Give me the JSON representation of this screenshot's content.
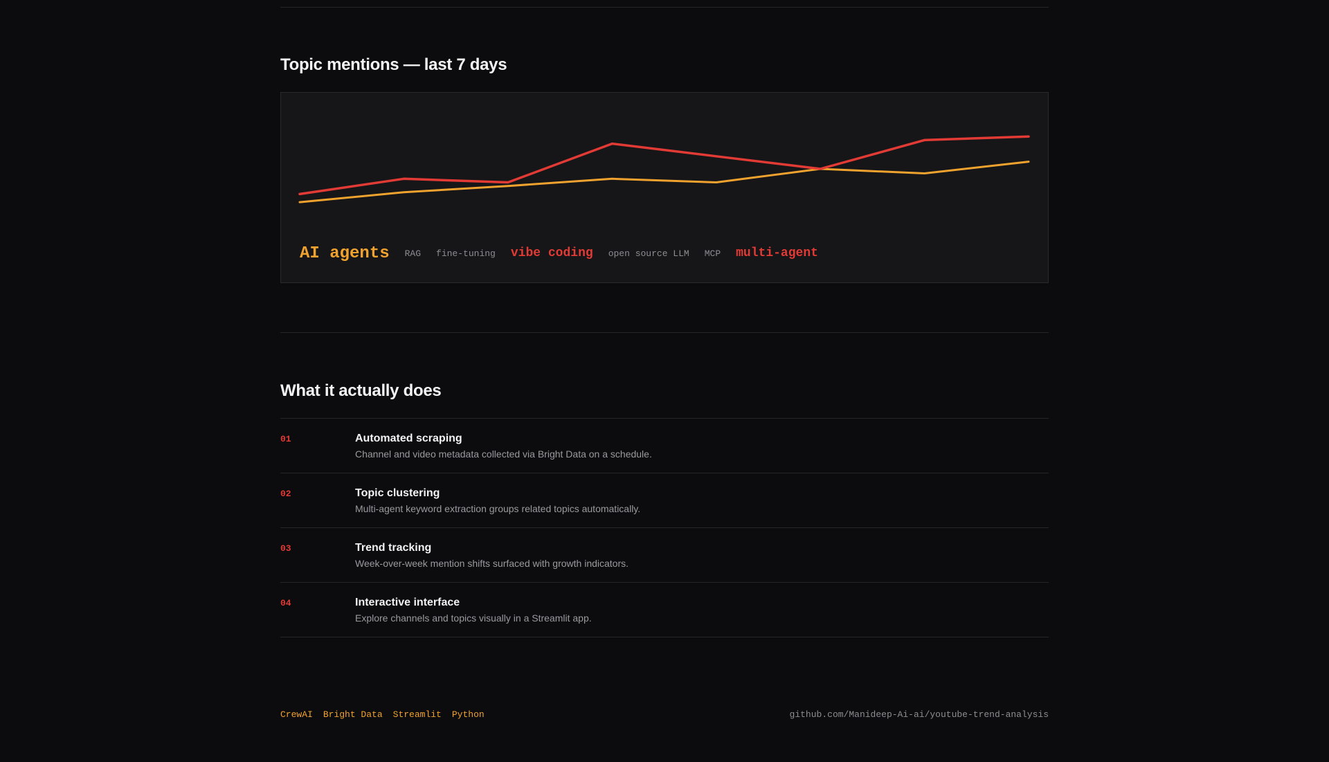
{
  "chart_section": {
    "title": "Topic mentions — last 7 days"
  },
  "chart_data": {
    "type": "line",
    "title": "Topic mentions — last 7 days",
    "x": [
      1,
      2,
      3,
      4,
      5,
      6,
      7,
      8
    ],
    "ylim": [
      0,
      100
    ],
    "grid": false,
    "series": [
      {
        "color": "#e23a34",
        "values": [
          22,
          39,
          35,
          78,
          64,
          50,
          82,
          86
        ]
      },
      {
        "color": "#f0a22e",
        "values": [
          13,
          24,
          31,
          39,
          35,
          50,
          45,
          58
        ]
      }
    ]
  },
  "topics": [
    {
      "label": "AI agents",
      "size": "lg",
      "color": "#f0a22e"
    },
    {
      "label": "RAG",
      "size": "sm",
      "color": "#8d8d92"
    },
    {
      "label": "fine-tuning",
      "size": "sm",
      "color": "#8d8d92"
    },
    {
      "label": "vibe coding",
      "size": "md",
      "color": "#e23a34"
    },
    {
      "label": "open source LLM",
      "size": "sm",
      "color": "#8d8d92"
    },
    {
      "label": "MCP",
      "size": "sm",
      "color": "#8d8d92"
    },
    {
      "label": "multi-agent",
      "size": "md",
      "color": "#e23a34"
    }
  ],
  "features_section": {
    "title": "What it actually does",
    "items": [
      {
        "num": "01",
        "title": "Automated scraping",
        "desc": "Channel and video metadata collected via Bright Data on a schedule."
      },
      {
        "num": "02",
        "title": "Topic clustering",
        "desc": "Multi-agent keyword extraction groups related topics automatically."
      },
      {
        "num": "03",
        "title": "Trend tracking",
        "desc": "Week-over-week mention shifts surfaced with growth indicators."
      },
      {
        "num": "04",
        "title": "Interactive interface",
        "desc": "Explore channels and topics visually in a Streamlit app."
      }
    ]
  },
  "footer": {
    "tech": [
      "CrewAI",
      "Bright Data",
      "Streamlit",
      "Python"
    ],
    "repo": "github.com/Manideep-Ai-ai/youtube-trend-analysis"
  },
  "colors": {
    "accent_red": "#e23a34",
    "accent_orange": "#f0a22e",
    "background": "#0c0c0e",
    "panel": "#161619"
  }
}
